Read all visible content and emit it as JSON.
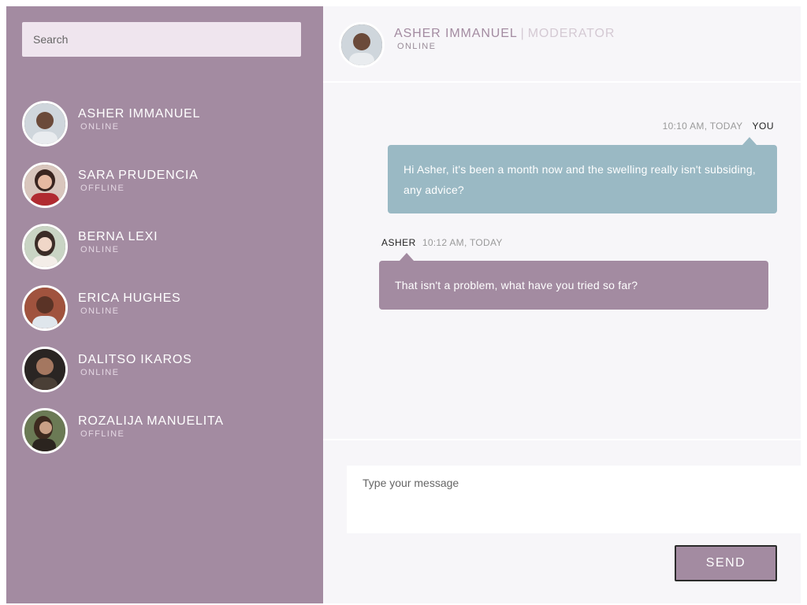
{
  "colors": {
    "sidebar_bg": "#a38ba1",
    "search_bg": "#efe5ee",
    "chat_bg": "#f7f6f9",
    "bubble_you": "#9ab9c4",
    "bubble_them": "#a38ba1",
    "accent": "#a38ba1"
  },
  "search": {
    "placeholder": "Search"
  },
  "contacts": [
    {
      "name": "ASHER IMMANUEL",
      "status": "ONLINE"
    },
    {
      "name": "SARA PRUDENCIA",
      "status": "OFFLINE"
    },
    {
      "name": "BERNA LEXI",
      "status": "ONLINE"
    },
    {
      "name": "ERICA HUGHES",
      "status": "ONLINE"
    },
    {
      "name": "DALITSO IKAROS",
      "status": "ONLINE"
    },
    {
      "name": "ROZALIJA MANUELITA",
      "status": "OFFLINE"
    }
  ],
  "header": {
    "name": "ASHER IMMANUEL",
    "separator": "|",
    "role": "MODERATOR",
    "status": "ONLINE"
  },
  "messages": [
    {
      "sender": "YOU",
      "time": "10:10 AM, TODAY",
      "text": "Hi Asher, it's been a month now and the swelling really isn't subsiding, any advice?"
    },
    {
      "sender": "ASHER",
      "time": "10:12 AM, TODAY",
      "text": "That isn't a problem, what have you tried so far?"
    }
  ],
  "composer": {
    "placeholder": "Type your message",
    "send_label": "SEND"
  }
}
